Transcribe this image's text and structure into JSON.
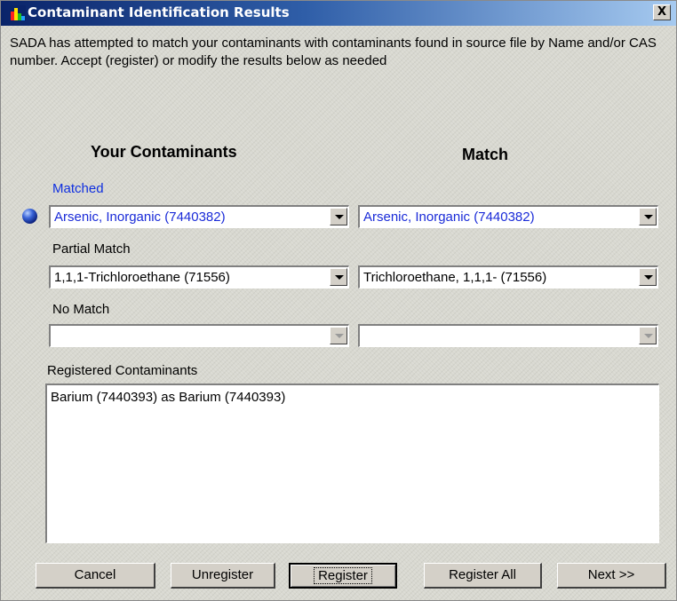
{
  "window": {
    "title": "Contaminant Identification Results",
    "close_label": "X"
  },
  "intro_text": "SADA has attempted to match your contaminants with contaminants found in source file by Name and/or CAS number.  Accept (register) or modify the results below as needed",
  "columns": {
    "left_header": "Your Contaminants",
    "right_header": "Match"
  },
  "groups": {
    "matched": {
      "label": "Matched",
      "your_value": "Arsenic, Inorganic (7440382)",
      "match_value": "Arsenic, Inorganic (7440382)"
    },
    "partial": {
      "label": "Partial Match",
      "your_value": "1,1,1-Trichloroethane (71556)",
      "match_value": "Trichloroethane, 1,1,1- (71556)"
    },
    "none": {
      "label": "No Match",
      "your_value": "",
      "match_value": ""
    }
  },
  "registered": {
    "label": "Registered Contaminants",
    "items": [
      "Barium (7440393) as Barium (7440393)"
    ]
  },
  "buttons": {
    "cancel": "Cancel",
    "unregister": "Unregister",
    "register": "Register",
    "register_all": "Register All",
    "next": "Next >>"
  },
  "colors": {
    "title_gradient_start": "#0a246a",
    "title_gradient_end": "#a6caf0",
    "matched_text": "#1a2bd8"
  },
  "icons": {
    "app": "bar-chart-icon",
    "selected_row": "blue-ball-icon"
  }
}
